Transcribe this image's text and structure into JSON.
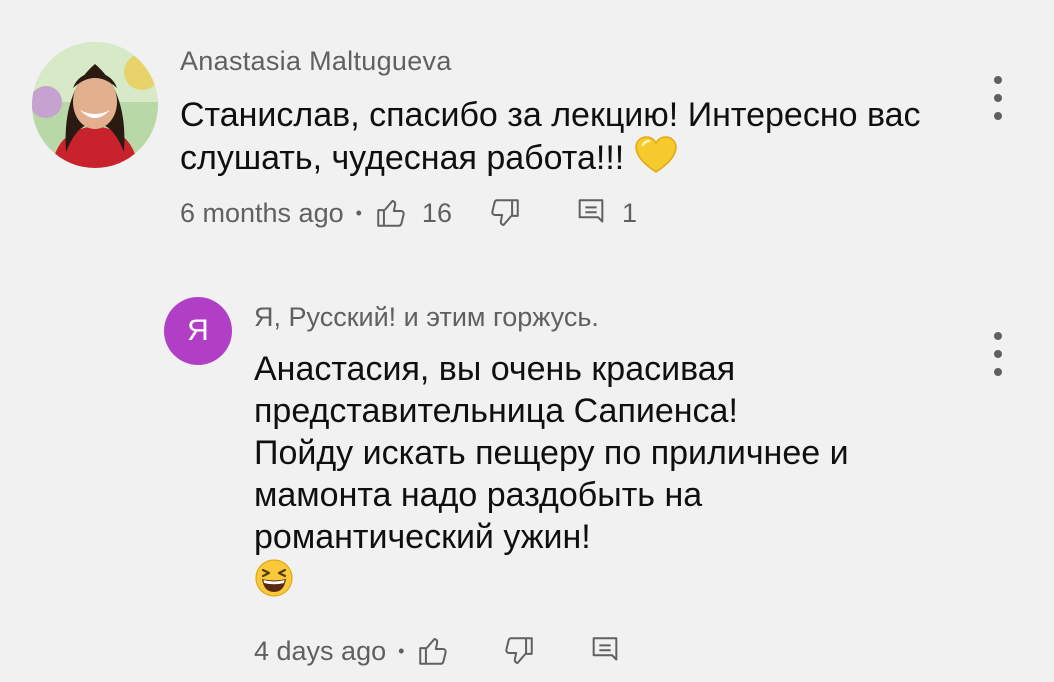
{
  "comments": [
    {
      "author": "Anastasia Maltugueva",
      "text": "Станислав, спасибо за лекцию! Интересно вас слушать, чудесная работа!!!",
      "emoji_icon": "yellow-heart-icon",
      "time": "6 months ago",
      "separator": "•",
      "likes": "16",
      "replies": "1"
    },
    {
      "author": "Я, Русский! и этим горжусь.",
      "avatar_letter": "Я",
      "avatar_color": "#b13fc6",
      "lines": [
        "Анастасия, вы очень красивая",
        "представительница Сапиенса!",
        "Пойду искать пещеру по приличнее и",
        "мамонта надо раздобыть на",
        "романтический ужин!"
      ],
      "emoji_icon": "grinning-squinting-face-icon",
      "time": "4 days ago",
      "separator": "•"
    }
  ],
  "colors": {
    "background": "#f1f1f1",
    "text_primary": "#0f0f0f",
    "text_secondary": "#606060"
  }
}
